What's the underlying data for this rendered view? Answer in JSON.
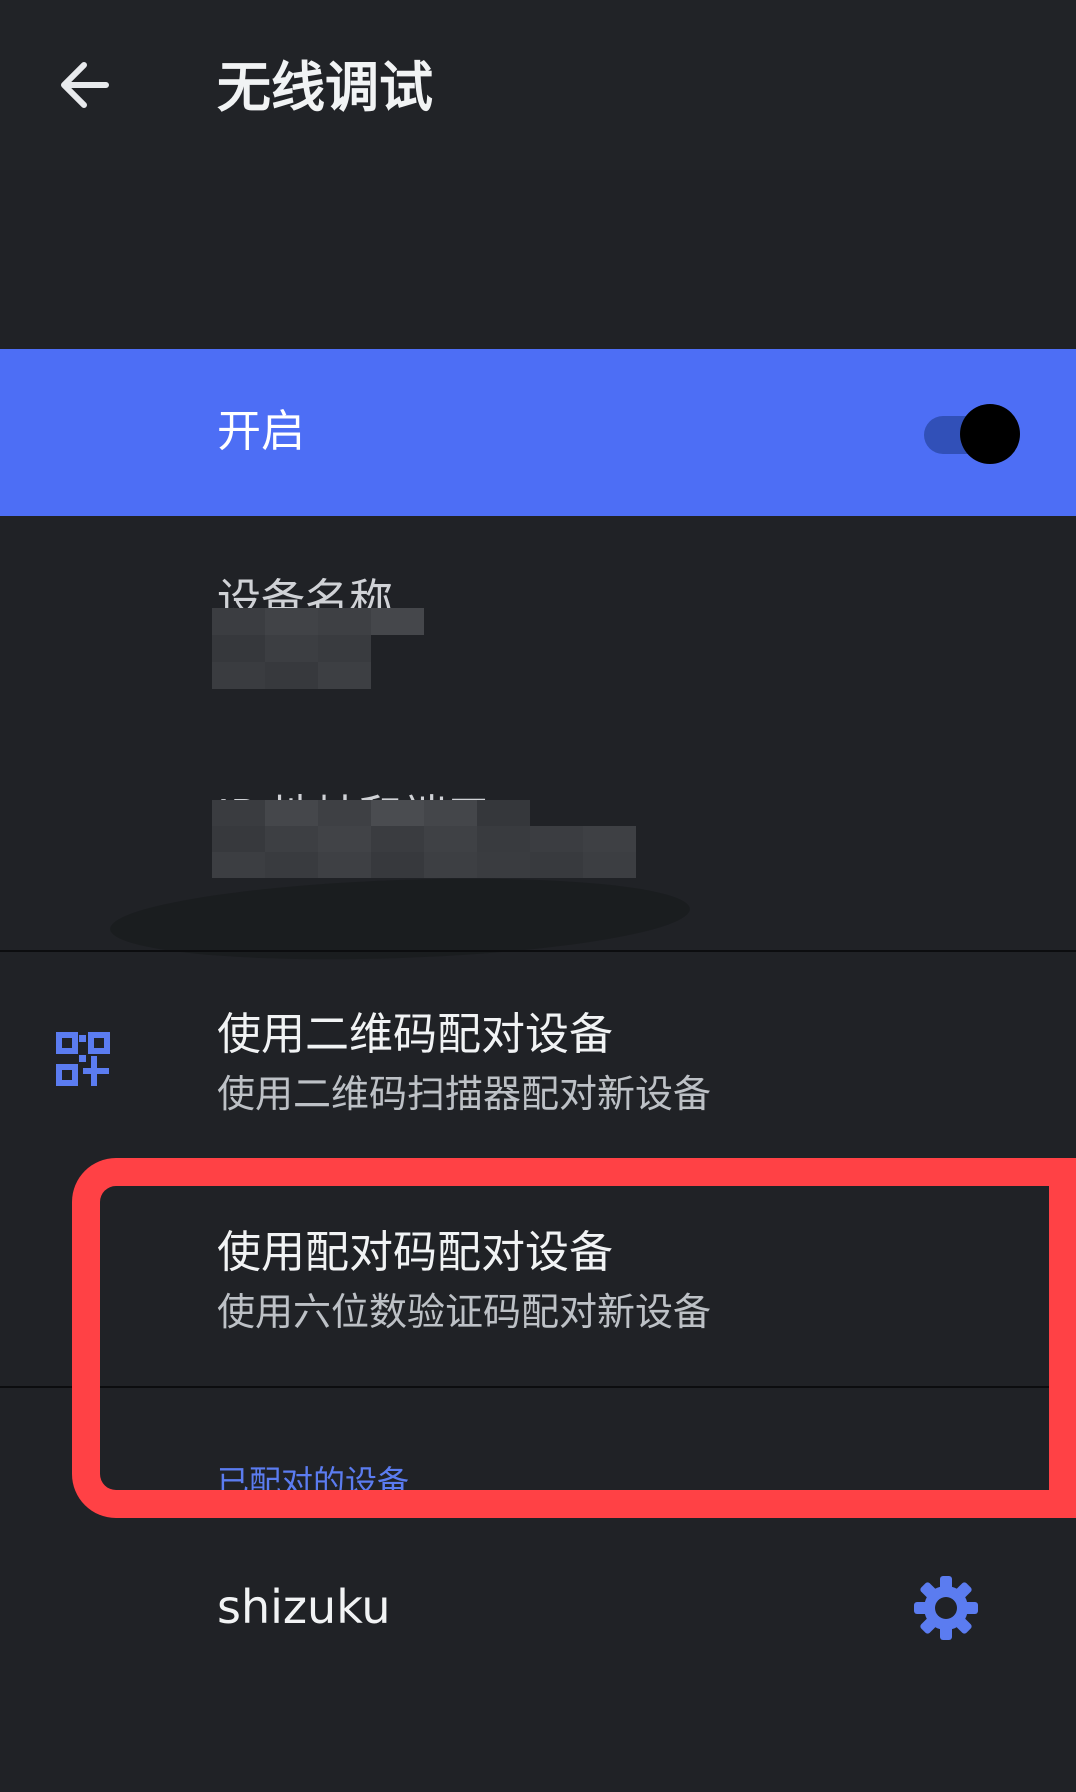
{
  "app_bar": {
    "title": "无线调试",
    "back_icon": "arrow-left-icon"
  },
  "main_switch": {
    "label": "开启",
    "enabled": true,
    "accent_color": "#4d6ef5"
  },
  "device_name": {
    "title": "设备名称"
  },
  "ip_address": {
    "title": "IP 地址和端口"
  },
  "pair_qr": {
    "title": "使用二维码配对设备",
    "summary": "使用二维码扫描器配对新设备",
    "icon": "qr-code-scanner-icon"
  },
  "pair_code": {
    "title": "使用配对码配对设备",
    "summary": "使用六位数验证码配对新设备"
  },
  "paired_devices": {
    "category": "已配对的设备",
    "items": [
      {
        "name": "shizuku",
        "settings_icon": "gear-icon"
      }
    ]
  },
  "colors": {
    "background": "#202226",
    "highlight_annotation": "#ff4145",
    "category_text": "#5b7cf0"
  }
}
